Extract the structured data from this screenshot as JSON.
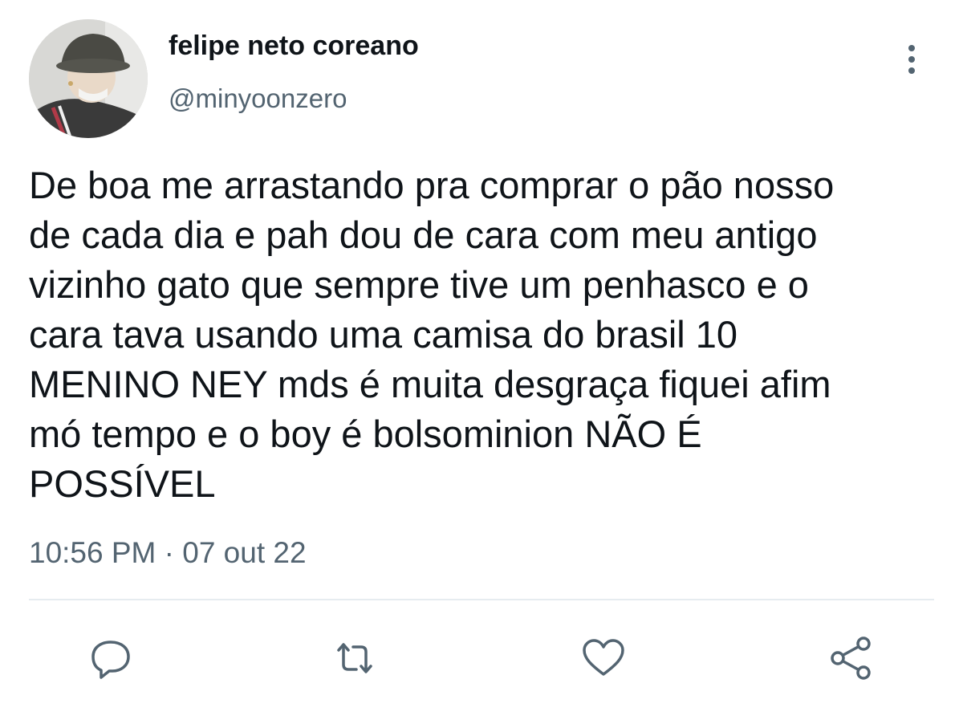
{
  "tweet": {
    "author": {
      "display_name": "felipe neto coreano",
      "handle": "@minyoonzero"
    },
    "text": "De boa me arrastando pra comprar o pão nosso\nde cada dia e pah dou de cara com meu antigo\nvizinho gato que sempre tive um penhasco e o\ncara tava usando uma camisa do brasil 10\nMENINO NEY mds é muita desgraça fiquei afim\nmó tempo e o boy é bolsominion NÃO É\nPOSSÍVEL",
    "timestamp": "10:56 PM · 07 out 22"
  },
  "icons": {
    "more": "more-vertical-icon",
    "reply": "reply-icon",
    "retweet": "retweet-icon",
    "like": "heart-icon",
    "share": "share-icon"
  },
  "colors": {
    "text_primary": "#0f1419",
    "text_secondary": "#536471",
    "icon": "#536471",
    "divider": "#e6ecf0"
  }
}
